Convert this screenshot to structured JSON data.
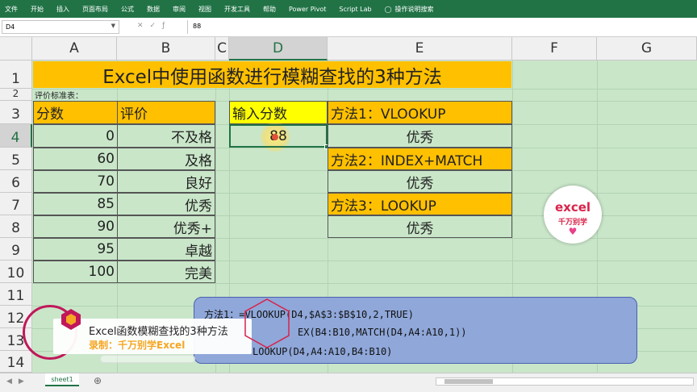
{
  "ribbon": {
    "tabs": [
      "文件",
      "开始",
      "插入",
      "页面布局",
      "公式",
      "数据",
      "审阅",
      "视图",
      "开发工具",
      "帮助",
      "Power Pivot",
      "Script Lab"
    ],
    "tell_me": "操作说明搜索"
  },
  "formula_bar": {
    "name_box": "D4",
    "value": "88"
  },
  "columns": [
    "A",
    "B",
    "C",
    "D",
    "E",
    "F",
    "G"
  ],
  "rows": [
    "1",
    "2",
    "3",
    "4",
    "5",
    "6",
    "7",
    "8",
    "9",
    "10",
    "11",
    "12",
    "13",
    "14"
  ],
  "sheet": {
    "title": "Excel中使用函数进行模糊查找的3种方法",
    "criteria_label": "评价标准表：",
    "table_headers": {
      "score": "分数",
      "rating": "评价"
    },
    "table": [
      {
        "score": "0",
        "rating": "不及格"
      },
      {
        "score": "60",
        "rating": "及格"
      },
      {
        "score": "70",
        "rating": "良好"
      },
      {
        "score": "85",
        "rating": "优秀"
      },
      {
        "score": "90",
        "rating": "优秀+"
      },
      {
        "score": "95",
        "rating": "卓越"
      },
      {
        "score": "100",
        "rating": "完美"
      }
    ],
    "input_label": "输入分数",
    "input_value": "88",
    "methods": [
      {
        "label": "方法1：VLOOKUP",
        "result": "优秀"
      },
      {
        "label": "方法2：INDEX+MATCH",
        "result": "优秀"
      },
      {
        "label": "方法3：LOOKUP",
        "result": "优秀"
      }
    ]
  },
  "formulas": {
    "line1": "方法1：=VLOOKUP(D4,$A$3:$B$10,2,TRUE)",
    "line2": "EX(B4:B10,MATCH(D4,A4:A10,1))",
    "line3": "LOOKUP(D4,A4:A10,B4:B10)"
  },
  "badge": {
    "line1": "excel",
    "line2": "千万别学"
  },
  "overlay": {
    "title": "Excel函数模糊查找的3种方法",
    "subtitle": "录制：千万别学Excel"
  },
  "sheet_tab": "sheet1",
  "colors": {
    "excel_green": "#217346",
    "header_orange": "#ffc000",
    "input_yellow": "#ffff00",
    "sheet_bg": "#c9e6c9"
  }
}
